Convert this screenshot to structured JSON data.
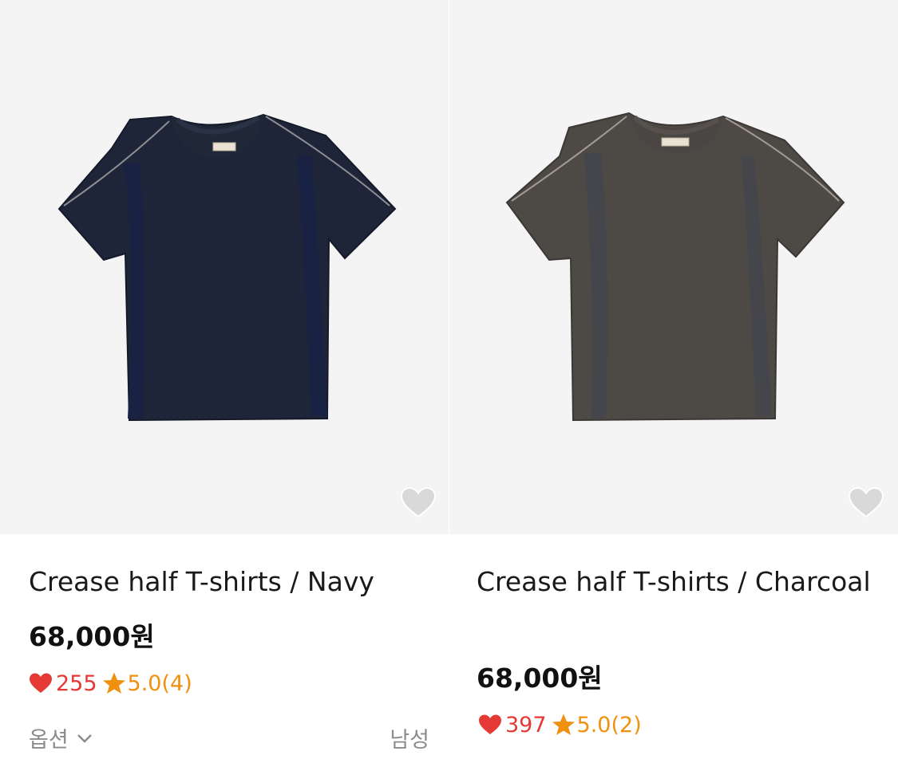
{
  "products": [
    {
      "name": "Crease half T-shirts / Navy",
      "price": "68,000원",
      "likes": "255",
      "rating": "5.0(4)",
      "option_label": "옵션",
      "gender": "남성",
      "color": "#1e2538",
      "image_alt": "navy t-shirt"
    },
    {
      "name": "Crease half T-shirts / Charcoal",
      "price": "68,000원",
      "likes": "397",
      "rating": "5.0(2)",
      "color": "#4d4945",
      "image_alt": "charcoal t-shirt"
    }
  ],
  "icons": {
    "wishlist": "heart-outline-icon",
    "like": "heart-icon",
    "rating": "star-icon",
    "dropdown": "chevron-down-icon"
  },
  "colors": {
    "like": "#e53935",
    "rating": "#f0900f",
    "muted": "#8b8b8b",
    "image_bg": "#f4f4f4"
  }
}
